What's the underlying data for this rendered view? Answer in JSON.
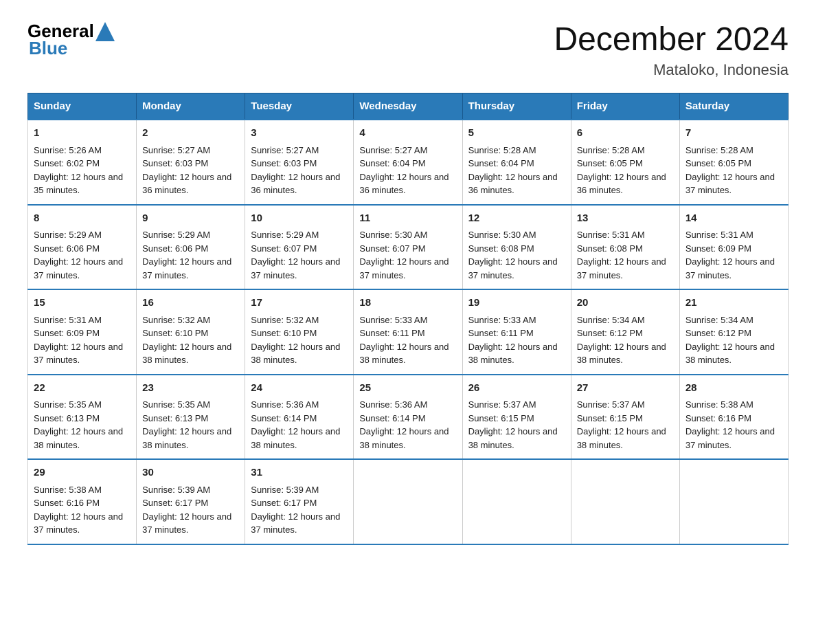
{
  "logo": {
    "text_general": "General",
    "text_blue": "Blue"
  },
  "title": "December 2024",
  "subtitle": "Mataloko, Indonesia",
  "headers": [
    "Sunday",
    "Monday",
    "Tuesday",
    "Wednesday",
    "Thursday",
    "Friday",
    "Saturday"
  ],
  "weeks": [
    [
      {
        "day": "1",
        "sunrise": "5:26 AM",
        "sunset": "6:02 PM",
        "daylight": "12 hours and 35 minutes."
      },
      {
        "day": "2",
        "sunrise": "5:27 AM",
        "sunset": "6:03 PM",
        "daylight": "12 hours and 36 minutes."
      },
      {
        "day": "3",
        "sunrise": "5:27 AM",
        "sunset": "6:03 PM",
        "daylight": "12 hours and 36 minutes."
      },
      {
        "day": "4",
        "sunrise": "5:27 AM",
        "sunset": "6:04 PM",
        "daylight": "12 hours and 36 minutes."
      },
      {
        "day": "5",
        "sunrise": "5:28 AM",
        "sunset": "6:04 PM",
        "daylight": "12 hours and 36 minutes."
      },
      {
        "day": "6",
        "sunrise": "5:28 AM",
        "sunset": "6:05 PM",
        "daylight": "12 hours and 36 minutes."
      },
      {
        "day": "7",
        "sunrise": "5:28 AM",
        "sunset": "6:05 PM",
        "daylight": "12 hours and 37 minutes."
      }
    ],
    [
      {
        "day": "8",
        "sunrise": "5:29 AM",
        "sunset": "6:06 PM",
        "daylight": "12 hours and 37 minutes."
      },
      {
        "day": "9",
        "sunrise": "5:29 AM",
        "sunset": "6:06 PM",
        "daylight": "12 hours and 37 minutes."
      },
      {
        "day": "10",
        "sunrise": "5:29 AM",
        "sunset": "6:07 PM",
        "daylight": "12 hours and 37 minutes."
      },
      {
        "day": "11",
        "sunrise": "5:30 AM",
        "sunset": "6:07 PM",
        "daylight": "12 hours and 37 minutes."
      },
      {
        "day": "12",
        "sunrise": "5:30 AM",
        "sunset": "6:08 PM",
        "daylight": "12 hours and 37 minutes."
      },
      {
        "day": "13",
        "sunrise": "5:31 AM",
        "sunset": "6:08 PM",
        "daylight": "12 hours and 37 minutes."
      },
      {
        "day": "14",
        "sunrise": "5:31 AM",
        "sunset": "6:09 PM",
        "daylight": "12 hours and 37 minutes."
      }
    ],
    [
      {
        "day": "15",
        "sunrise": "5:31 AM",
        "sunset": "6:09 PM",
        "daylight": "12 hours and 37 minutes."
      },
      {
        "day": "16",
        "sunrise": "5:32 AM",
        "sunset": "6:10 PM",
        "daylight": "12 hours and 38 minutes."
      },
      {
        "day": "17",
        "sunrise": "5:32 AM",
        "sunset": "6:10 PM",
        "daylight": "12 hours and 38 minutes."
      },
      {
        "day": "18",
        "sunrise": "5:33 AM",
        "sunset": "6:11 PM",
        "daylight": "12 hours and 38 minutes."
      },
      {
        "day": "19",
        "sunrise": "5:33 AM",
        "sunset": "6:11 PM",
        "daylight": "12 hours and 38 minutes."
      },
      {
        "day": "20",
        "sunrise": "5:34 AM",
        "sunset": "6:12 PM",
        "daylight": "12 hours and 38 minutes."
      },
      {
        "day": "21",
        "sunrise": "5:34 AM",
        "sunset": "6:12 PM",
        "daylight": "12 hours and 38 minutes."
      }
    ],
    [
      {
        "day": "22",
        "sunrise": "5:35 AM",
        "sunset": "6:13 PM",
        "daylight": "12 hours and 38 minutes."
      },
      {
        "day": "23",
        "sunrise": "5:35 AM",
        "sunset": "6:13 PM",
        "daylight": "12 hours and 38 minutes."
      },
      {
        "day": "24",
        "sunrise": "5:36 AM",
        "sunset": "6:14 PM",
        "daylight": "12 hours and 38 minutes."
      },
      {
        "day": "25",
        "sunrise": "5:36 AM",
        "sunset": "6:14 PM",
        "daylight": "12 hours and 38 minutes."
      },
      {
        "day": "26",
        "sunrise": "5:37 AM",
        "sunset": "6:15 PM",
        "daylight": "12 hours and 38 minutes."
      },
      {
        "day": "27",
        "sunrise": "5:37 AM",
        "sunset": "6:15 PM",
        "daylight": "12 hours and 38 minutes."
      },
      {
        "day": "28",
        "sunrise": "5:38 AM",
        "sunset": "6:16 PM",
        "daylight": "12 hours and 37 minutes."
      }
    ],
    [
      {
        "day": "29",
        "sunrise": "5:38 AM",
        "sunset": "6:16 PM",
        "daylight": "12 hours and 37 minutes."
      },
      {
        "day": "30",
        "sunrise": "5:39 AM",
        "sunset": "6:17 PM",
        "daylight": "12 hours and 37 minutes."
      },
      {
        "day": "31",
        "sunrise": "5:39 AM",
        "sunset": "6:17 PM",
        "daylight": "12 hours and 37 minutes."
      },
      null,
      null,
      null,
      null
    ]
  ]
}
